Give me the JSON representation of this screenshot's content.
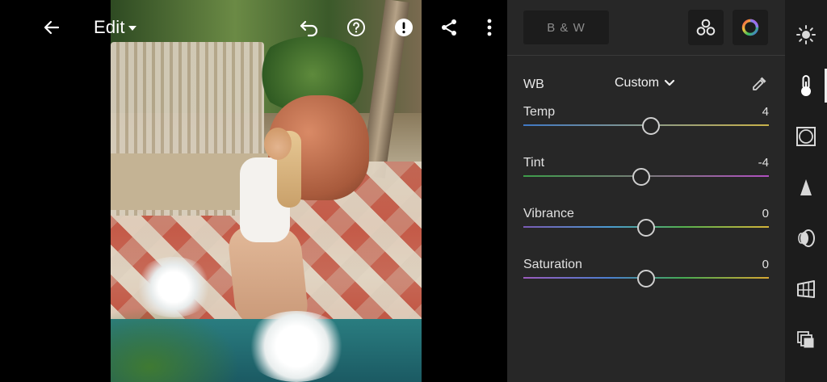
{
  "toolbar": {
    "edit_label": "Edit"
  },
  "panel": {
    "bw_label": "B & W",
    "wb": {
      "label": "WB",
      "value": "Custom"
    },
    "sliders": [
      {
        "label": "Temp",
        "value": "4",
        "position": 0.52
      },
      {
        "label": "Tint",
        "value": "-4",
        "position": 0.48
      },
      {
        "label": "Vibrance",
        "value": "0",
        "position": 0.5
      },
      {
        "label": "Saturation",
        "value": "0",
        "position": 0.5
      }
    ]
  },
  "rail": {
    "active_tool": "color-icon",
    "tools": [
      "light-icon",
      "color-icon",
      "vignette-icon",
      "detail-icon",
      "optics-icon",
      "geometry-icon",
      "versions-icon"
    ]
  },
  "colors": {
    "panel_bg": "#272727",
    "rail_bg": "#1c1c1c",
    "temp_track": [
      "#3f78c4",
      "#c8b24a"
    ],
    "tint_track": [
      "#3d9d4a",
      "#b04fc0"
    ],
    "vibrance_track": [
      "#7a5bb5",
      "#4a9ad0",
      "#54b04e",
      "#d4b43a"
    ],
    "saturation_track": [
      "#9c5bbd",
      "#4b7fd0",
      "#45aa52",
      "#d8a833"
    ]
  }
}
